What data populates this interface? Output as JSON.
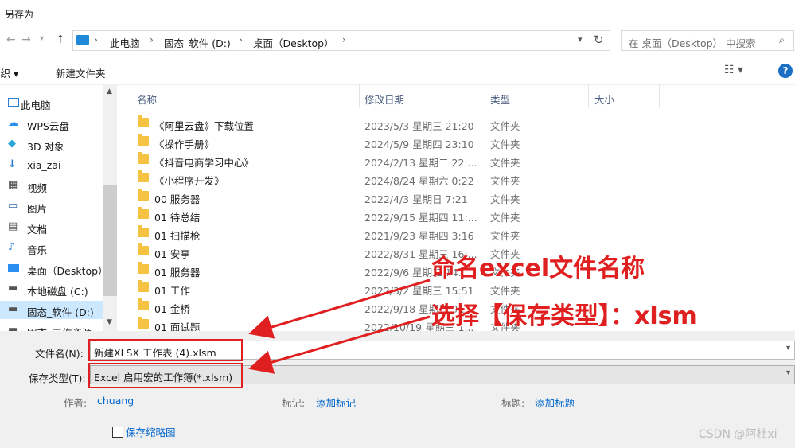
{
  "window": {
    "title": "另存为"
  },
  "address": {
    "crumbs": [
      "此电脑",
      "固态_软件 (D:)",
      "桌面（Desktop）"
    ],
    "search_placeholder": "在 桌面（Desktop） 中搜索"
  },
  "toolbar": {
    "organize": "组织",
    "new_folder": "新建文件夹"
  },
  "nav": {
    "items": [
      "此电脑",
      "WPS云盘",
      "3D 对象",
      "xia_zai",
      "视频",
      "图片",
      "文档",
      "音乐",
      "桌面（Desktop）",
      "本地磁盘 (C:)",
      "固态_软件 (D:)",
      "固态_工作资源"
    ]
  },
  "columns": {
    "name": "名称",
    "date": "修改日期",
    "type": "类型",
    "size": "大小"
  },
  "files": [
    {
      "name": "《阿里云盘》下载位置",
      "date": "2023/5/3 星期三 21:20",
      "type": "文件夹"
    },
    {
      "name": "《操作手册》",
      "date": "2024/5/9 星期四 23:10",
      "type": "文件夹"
    },
    {
      "name": "《抖音电商学习中心》",
      "date": "2024/2/13 星期二 22:...",
      "type": "文件夹"
    },
    {
      "name": "《小程序开发》",
      "date": "2024/8/24 星期六 0:22",
      "type": "文件夹"
    },
    {
      "name": "00  服务器",
      "date": "2022/4/3 星期日 7:21",
      "type": "文件夹"
    },
    {
      "name": "01   待总结",
      "date": "2022/9/15 星期四 11:...",
      "type": "文件夹"
    },
    {
      "name": "01   扫描枪",
      "date": "2021/9/23 星期四 3:16",
      "type": "文件夹"
    },
    {
      "name": "01  安亭",
      "date": "2022/8/31 星期三 16:...",
      "type": "文件夹"
    },
    {
      "name": "01  服务器",
      "date": "2022/9/6 星期二 14:...",
      "type": "文件夹"
    },
    {
      "name": "01  工作",
      "date": "2022/3/2 星期三 15:51",
      "type": "文件夹"
    },
    {
      "name": "01  金桥",
      "date": "2022/9/18 星期日 9:...",
      "type": "文件夹"
    },
    {
      "name": "01  面试题",
      "date": "2022/10/19 星期三 1...",
      "type": "文件夹"
    }
  ],
  "form": {
    "filename_label": "文件名(N):",
    "filename_value": "新建XLSX 工作表 (4).xlsm",
    "filetype_label": "保存类型(T):",
    "filetype_value": "Excel 启用宏的工作簿(*.xlsm)",
    "author_label": "作者:",
    "author_value": "chuang",
    "tags_label": "标记:",
    "tags_value": "添加标记",
    "title_label": "标题:",
    "title_value": "添加标题",
    "thumbnail_label": "保存缩略图"
  },
  "annotations": {
    "a1": "命名excel文件名称",
    "a2": "选择【保存类型】：xlsm"
  },
  "watermark": "CSDN @阿杜xi",
  "colors": {
    "annotation_red": "#e02020",
    "selection": "#cce8ff",
    "link": "#0066cc"
  }
}
